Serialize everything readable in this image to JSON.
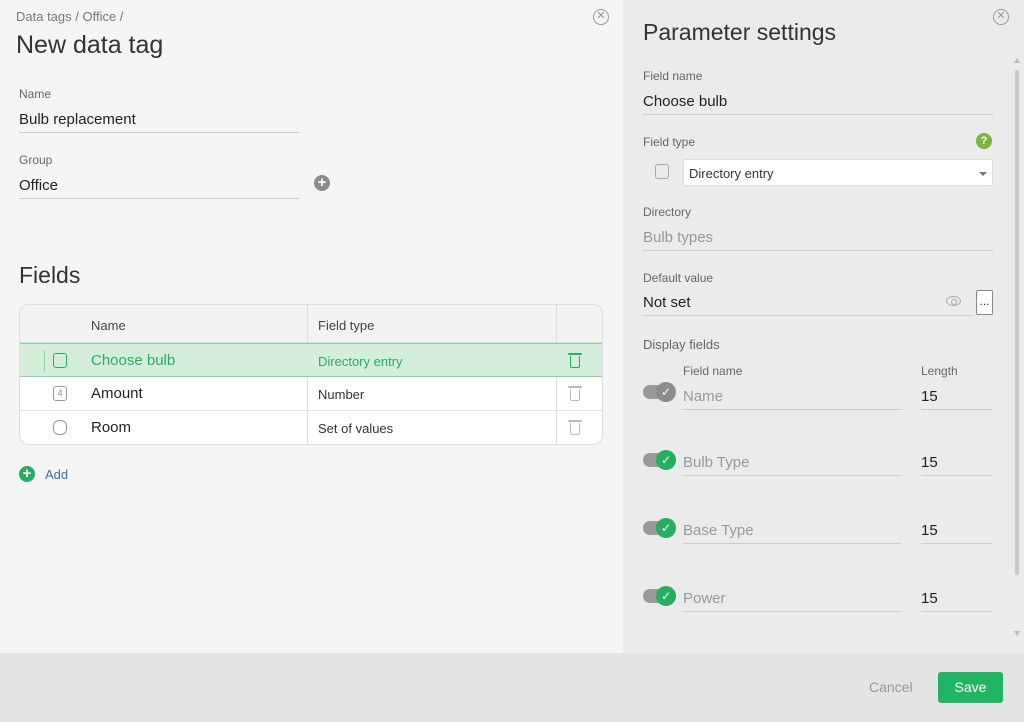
{
  "left": {
    "breadcrumb": "Data tags / Office /",
    "title": "New data tag",
    "name_label": "Name",
    "name_value": "Bulb replacement",
    "group_label": "Group",
    "group_value": "Office",
    "fields_title": "Fields",
    "table": {
      "col_name": "Name",
      "col_type": "Field type",
      "rows": [
        {
          "name": "Choose bulb",
          "type": "Directory entry",
          "icon": "directory-icon",
          "selected": true
        },
        {
          "name": "Amount",
          "type": "Number",
          "icon": "number-icon",
          "icon_glyph": "4"
        },
        {
          "name": "Room",
          "type": "Set of values",
          "icon": "set-icon"
        }
      ]
    },
    "add_label": "Add"
  },
  "right": {
    "title": "Parameter settings",
    "field_name_label": "Field name",
    "field_name_value": "Choose bulb",
    "field_type_label": "Field type",
    "field_type_value": "Directory entry",
    "help_glyph": "?",
    "directory_label": "Directory",
    "directory_value": "Bulb types",
    "default_label": "Default value",
    "default_value": "Not set",
    "dots_label": "...",
    "display_fields_label": "Display fields",
    "col_field_name": "Field name",
    "col_length": "Length",
    "display_fields": [
      {
        "name": "Name",
        "length": "15",
        "on": false
      },
      {
        "name": "Bulb Type",
        "length": "15",
        "on": true
      },
      {
        "name": "Base Type",
        "length": "15",
        "on": true
      },
      {
        "name": "Power",
        "length": "15",
        "on": true
      }
    ]
  },
  "footer": {
    "cancel_label": "Cancel",
    "save_label": "Save"
  },
  "colors": {
    "accent_green": "#27ae60",
    "save_green": "#21b464",
    "link_blue": "#3a6ea5"
  }
}
